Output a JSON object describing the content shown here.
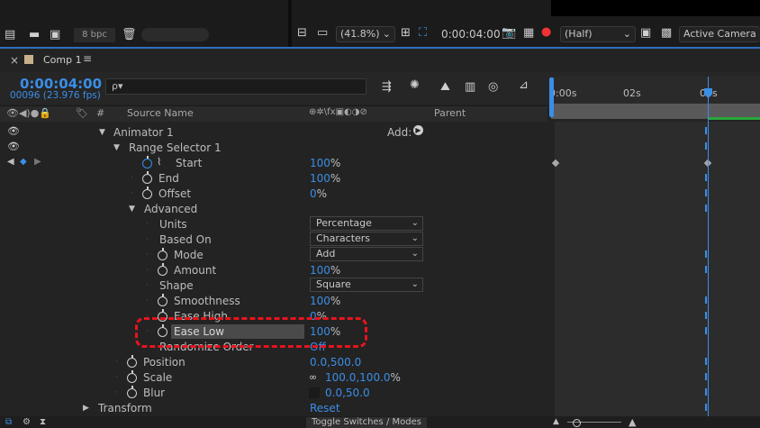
{
  "toolbar": {
    "bpc": "8 bpc",
    "zoom": "(41.8%)",
    "viewer_timecode": "0:00:04:00",
    "resolution": "(Half)",
    "camera": "Active Camera"
  },
  "comp": {
    "tab": "Comp 1",
    "timecode": "0:00:04:00",
    "frames": "00096 (23.976 fps)",
    "search_placeholder": "ρ▾"
  },
  "ruler": {
    "labels": [
      "0:00s",
      "02s",
      "04s"
    ]
  },
  "columns": {
    "num": "#",
    "source_name": "Source Name",
    "switches": "⊕✲\\fx▣◐◑⊘",
    "parent": "Parent"
  },
  "rows": {
    "animator": "Animator 1",
    "add_label": "Add:",
    "range_selector": "Range Selector 1",
    "start": {
      "label": "Start",
      "value": "100",
      "unit": "%"
    },
    "end": {
      "label": "End",
      "value": "100",
      "unit": "%"
    },
    "offset": {
      "label": "Offset",
      "value": "0",
      "unit": "%"
    },
    "advanced": "Advanced",
    "units": {
      "label": "Units",
      "value": "Percentage"
    },
    "based_on": {
      "label": "Based On",
      "value": "Characters"
    },
    "mode": {
      "label": "Mode",
      "value": "Add"
    },
    "amount": {
      "label": "Amount",
      "value": "100",
      "unit": "%"
    },
    "shape": {
      "label": "Shape",
      "value": "Square"
    },
    "smoothness": {
      "label": "Smoothness",
      "value": "100",
      "unit": "%"
    },
    "ease_high": {
      "label": "Ease High",
      "value": "0",
      "unit": "%"
    },
    "ease_low": {
      "label": "Ease Low",
      "value": "100",
      "unit": "%"
    },
    "randomize": {
      "label": "Randomize Order",
      "value": "Off"
    },
    "position": {
      "label": "Position",
      "value": "0.0,500.0"
    },
    "scale": {
      "label": "Scale",
      "value": "100.0,100.0",
      "unit": "%"
    },
    "blur": {
      "label": "Blur",
      "value": "0.0,50.0"
    },
    "transform": {
      "label": "Transform",
      "value": "Reset"
    }
  },
  "bottom": {
    "toggle": "Toggle Switches / Modes"
  },
  "colors": {
    "accent": "#3a8ee6",
    "annotation": "#e8141c",
    "work_area_green": "#29a83a"
  }
}
